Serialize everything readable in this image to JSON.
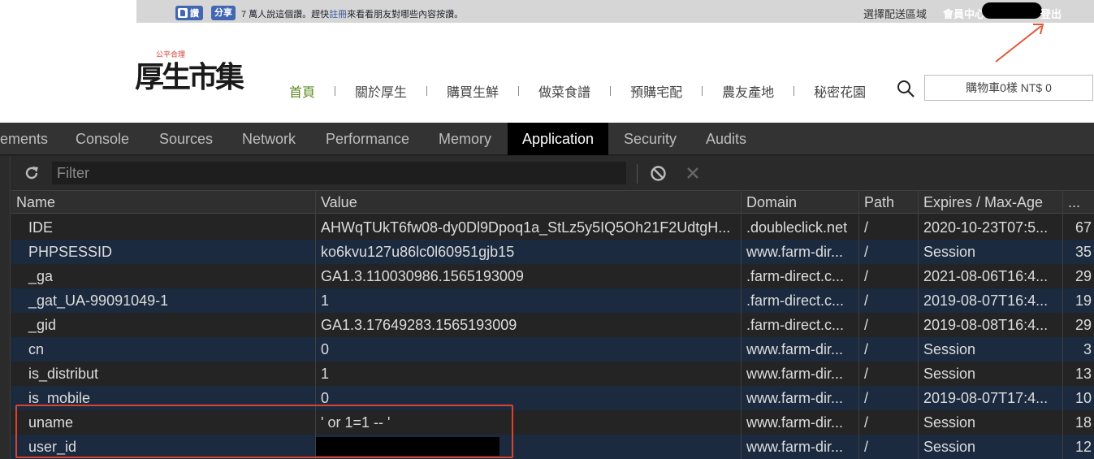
{
  "site": {
    "topbar": {
      "like_label": "讚",
      "share_label": "分享",
      "like_text_pre": "7 萬人說這個讚。趕快",
      "like_text_link": "註冊",
      "like_text_post": "來看看朋友對哪些內容按讚。",
      "delivery_label": "選擇配送區域",
      "member_label": "會員中心",
      "logout_label": "登出"
    },
    "logo": {
      "main": "厚生市集",
      "sub": "公平合理"
    },
    "nav": [
      {
        "label": "首頁"
      },
      {
        "label": "關於厚生"
      },
      {
        "label": "購買生鮮"
      },
      {
        "label": "做菜食譜"
      },
      {
        "label": "預購宅配"
      },
      {
        "label": "農友產地"
      },
      {
        "label": "秘密花園"
      }
    ],
    "cart_label": "購物車0樣 NT$ 0",
    "colors": {
      "nav_active": "#5a8a1e",
      "facebook": "#4267b2",
      "annotation": "#d9452c"
    }
  },
  "devtools": {
    "tabs": [
      {
        "label": "ements"
      },
      {
        "label": "Console"
      },
      {
        "label": "Sources"
      },
      {
        "label": "Network"
      },
      {
        "label": "Performance"
      },
      {
        "label": "Memory"
      },
      {
        "label": "Application"
      },
      {
        "label": "Security"
      },
      {
        "label": "Audits"
      }
    ],
    "active_tab": "Application",
    "filter_placeholder": "Filter",
    "columns": {
      "name": "Name",
      "value": "Value",
      "domain": "Domain",
      "path": "Path",
      "expires": "Expires / Max-Age",
      "size": "..."
    },
    "rows": [
      {
        "name": "IDE",
        "value": "AHWqTUkT6fw08-dy0Dl9Dpoq1a_StLz5y5IQ5Oh21F2UdtgH...",
        "domain": ".doubleclick.net",
        "path": "/",
        "expires": "2020-10-23T07:5...",
        "size": "67"
      },
      {
        "name": "PHPSESSID",
        "value": "ko6kvu127u86lc0l60951gjb15",
        "domain": "www.farm-dir...",
        "path": "/",
        "expires": "Session",
        "size": "35"
      },
      {
        "name": "_ga",
        "value": "GA1.3.110030986.1565193009",
        "domain": ".farm-direct.c...",
        "path": "/",
        "expires": "2021-08-06T16:4...",
        "size": "29"
      },
      {
        "name": "_gat_UA-99091049-1",
        "value": "1",
        "domain": ".farm-direct.c...",
        "path": "/",
        "expires": "2019-08-07T16:4...",
        "size": "19"
      },
      {
        "name": "_gid",
        "value": "GA1.3.17649283.1565193009",
        "domain": ".farm-direct.c...",
        "path": "/",
        "expires": "2019-08-08T16:4...",
        "size": "29"
      },
      {
        "name": "cn",
        "value": "0",
        "domain": "www.farm-dir...",
        "path": "/",
        "expires": "Session",
        "size": "3"
      },
      {
        "name": "is_distribut",
        "value": "1",
        "domain": "www.farm-dir...",
        "path": "/",
        "expires": "Session",
        "size": "13"
      },
      {
        "name": "is_mobile",
        "value": "0",
        "domain": "www.farm-dir...",
        "path": "/",
        "expires": "2019-08-07T17:4...",
        "size": "10"
      },
      {
        "name": "uname",
        "value": "' or 1=1 -- '",
        "domain": "www.farm-dir...",
        "path": "/",
        "expires": "Session",
        "size": "18"
      },
      {
        "name": "user_id",
        "value": "",
        "domain": "www.farm-dir...",
        "path": "/",
        "expires": "Session",
        "size": "12"
      }
    ],
    "colors": {
      "tabbar_bg": "#333333",
      "active_tab_bg": "#000000",
      "row_even": "#1b2a3f",
      "row_odd": "#242424"
    }
  }
}
